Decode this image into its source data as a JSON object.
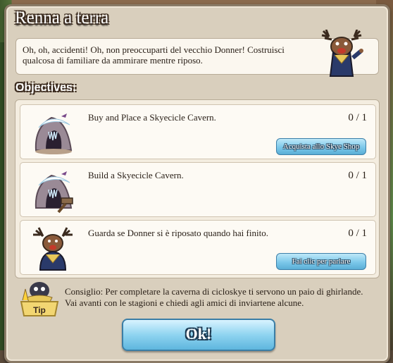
{
  "dialog": {
    "title": "Renna a terra",
    "close_icon": "close-icon",
    "intro": "Oh, oh, accidenti! Oh, non preoccuparti del vecchio Donner! Costruisci qualcosa di familiare da ammirare mentre riposo.",
    "objectives_heading": "Objectives:",
    "objectives": [
      {
        "text": "Buy and Place a Skyecicle Cavern.",
        "count": "0 / 1",
        "icon": "ice-cavern-icon",
        "button": "Acquista allo Skye Shop"
      },
      {
        "text": "Build a Skyecicle Cavern.",
        "count": "0 / 1",
        "icon": "ice-cavern-hammer-icon",
        "button": ""
      },
      {
        "text": "Guarda se Donner si è riposato quando hai finito.",
        "count": "0 / 1",
        "icon": "donner-reindeer-icon",
        "button": "Fai clic per parlare"
      }
    ],
    "tip_label": "Tip",
    "tip_text": "Consiglio: Per completare la caverna di cicloskye ti servono un paio di ghirlande. Vai avanti con le stagioni e chiedi agli amici di inviartene alcune.",
    "ok_label": "Ok!"
  },
  "colors": {
    "panel": "#d9cfbd",
    "button_blue": "#7cc8ea",
    "text": "#2a2018"
  }
}
